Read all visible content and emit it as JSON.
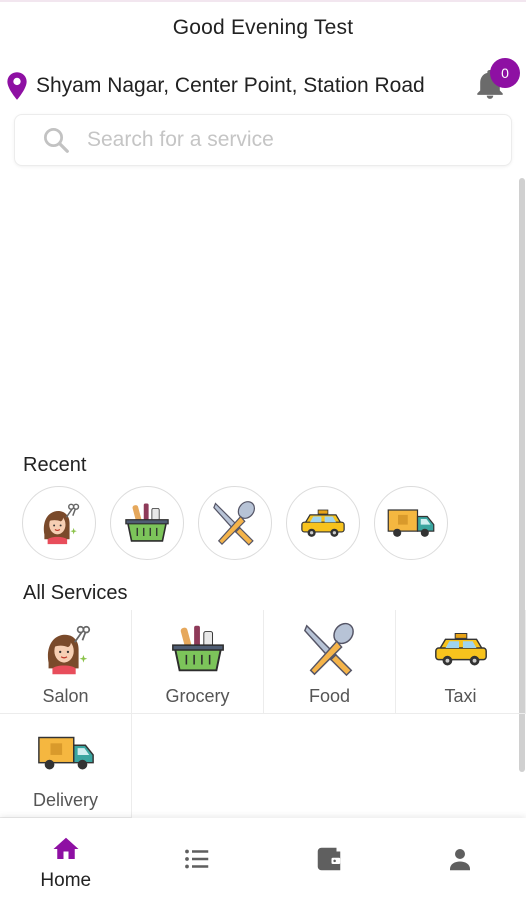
{
  "header": {
    "greeting": "Good Evening Test",
    "location": "Shyam Nagar, Center Point, Station Road",
    "notification_count": "0"
  },
  "search": {
    "placeholder": "Search for a service"
  },
  "recent": {
    "title": "Recent",
    "items": [
      {
        "icon": "salon-icon"
      },
      {
        "icon": "grocery-icon"
      },
      {
        "icon": "food-icon"
      },
      {
        "icon": "taxi-icon"
      },
      {
        "icon": "delivery-icon"
      }
    ]
  },
  "all_services": {
    "title": "All Services",
    "items": [
      {
        "label": "Salon",
        "icon": "salon-icon"
      },
      {
        "label": "Grocery",
        "icon": "grocery-icon"
      },
      {
        "label": "Food",
        "icon": "food-icon"
      },
      {
        "label": "Taxi",
        "icon": "taxi-icon"
      },
      {
        "label": "Delivery",
        "icon": "delivery-icon"
      }
    ]
  },
  "bottom_nav": {
    "items": [
      {
        "label": "Home",
        "icon": "home-icon",
        "active": true
      },
      {
        "label": "",
        "icon": "list-icon",
        "active": false
      },
      {
        "label": "",
        "icon": "wallet-icon",
        "active": false
      },
      {
        "label": "",
        "icon": "profile-icon",
        "active": false
      }
    ]
  },
  "colors": {
    "accent": "#8e10a3",
    "icon_gray": "#5f5f5f",
    "text": "#222222"
  }
}
